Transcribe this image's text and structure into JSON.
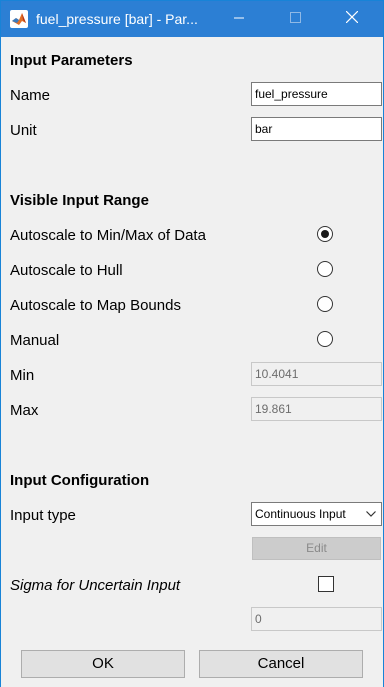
{
  "window": {
    "title": "fuel_pressure [bar] - Par...",
    "accent_color": "#2c7fd4"
  },
  "input_parameters": {
    "header": "Input Parameters",
    "name_label": "Name",
    "name_value": "fuel_pressure",
    "unit_label": "Unit",
    "unit_value": "bar"
  },
  "visible_input_range": {
    "header": "Visible Input Range",
    "options": [
      {
        "label": "Autoscale to Min/Max of Data",
        "selected": true
      },
      {
        "label": "Autoscale to Hull",
        "selected": false
      },
      {
        "label": "Autoscale to Map Bounds",
        "selected": false
      },
      {
        "label": "Manual",
        "selected": false
      }
    ],
    "min_label": "Min",
    "min_value": "10.4041",
    "max_label": "Max",
    "max_value": "19.861"
  },
  "input_configuration": {
    "header": "Input Configuration",
    "type_label": "Input type",
    "type_value": "Continuous Input",
    "edit_label": "Edit",
    "sigma_label": "Sigma for Uncertain Input",
    "sigma_checked": false,
    "sigma_value": "0"
  },
  "buttons": {
    "ok": "OK",
    "cancel": "Cancel"
  }
}
